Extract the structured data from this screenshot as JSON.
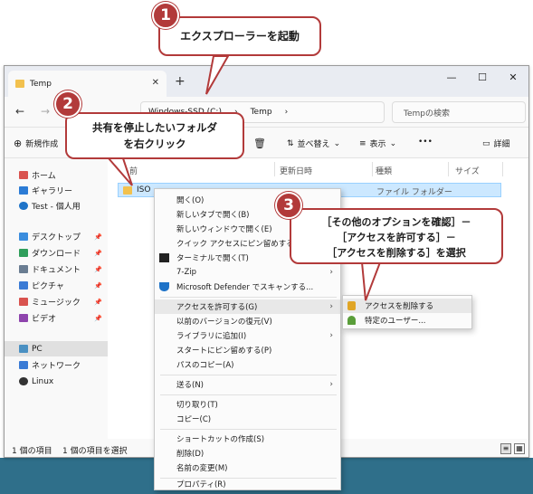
{
  "window": {
    "tab_title": "Temp",
    "controls": [
      "—",
      "☐",
      "✕"
    ],
    "address": {
      "drive": "Windows-SSD (C:)",
      "folder": "Temp"
    },
    "search_placeholder": "Tempの検索"
  },
  "toolbar": {
    "new_label": "新規作成",
    "sort_label": "並べ替え",
    "view_label": "表示",
    "more_label": "•••",
    "details_label": "詳細"
  },
  "navpane": {
    "items": [
      {
        "label": "ホーム",
        "icon": "home-icon",
        "color": "#d9534f"
      },
      {
        "label": "ギャラリー",
        "icon": "gallery-icon",
        "color": "#2b7bd5"
      },
      {
        "label": "Test - 個人用",
        "icon": "cloud-icon",
        "color": "#1e73c8"
      },
      {
        "label": "デスクトップ",
        "icon": "desktop-icon",
        "color": "#3a8dde",
        "pinned": true
      },
      {
        "label": "ダウンロード",
        "icon": "download-icon",
        "color": "#2f9e5b",
        "pinned": true
      },
      {
        "label": "ドキュメント",
        "icon": "documents-icon",
        "color": "#6a7d92",
        "pinned": true
      },
      {
        "label": "ピクチャ",
        "icon": "pictures-icon",
        "color": "#3a7bd5",
        "pinned": true
      },
      {
        "label": "ミュージック",
        "icon": "music-icon",
        "color": "#d9534f",
        "pinned": true
      },
      {
        "label": "ビデオ",
        "icon": "video-icon",
        "color": "#8e44ad",
        "pinned": true
      },
      {
        "label": "PC",
        "icon": "pc-icon",
        "color": "#4a90c2"
      },
      {
        "label": "ネットワーク",
        "icon": "network-icon",
        "color": "#3a7bd5"
      },
      {
        "label": "Linux",
        "icon": "linux-icon",
        "color": "#333333"
      }
    ]
  },
  "columns": {
    "name": "前",
    "modified": "更新日時",
    "type": "種類",
    "size": "サイズ"
  },
  "file": {
    "name": "ISO",
    "type": "ファイル フォルダー"
  },
  "status": {
    "count": "1 個の項目",
    "selected": "1 個の項目を選択"
  },
  "context_menu": {
    "items": [
      "開く(O)",
      "新しいタブで開く(B)",
      "新しいウィンドウで開く(E)",
      "クイック アクセスにピン留めする(Q)",
      "ターミナルで開く(T)",
      "7-Zip",
      "Microsoft Defender でスキャンする...",
      "アクセスを許可する(G)",
      "以前のバージョンの復元(V)",
      "ライブラリに追加(I)",
      "スタートにピン留めする(P)",
      "パスのコピー(A)",
      "送る(N)",
      "切り取り(T)",
      "コピー(C)",
      "ショートカットの作成(S)",
      "削除(D)",
      "名前の変更(M)",
      "プロパティ(R)"
    ],
    "submenu": [
      "アクセスを削除する",
      "特定のユーザー..."
    ]
  },
  "callouts": {
    "c1": {
      "num": "1",
      "text": "エクスプローラーを起動"
    },
    "c2": {
      "num": "2",
      "line1": "共有を停止したいフォルダ",
      "line2": "を右クリック"
    },
    "c3": {
      "num": "3",
      "line1": "［その他のオプションを確認］－",
      "line2": "［アクセスを許可する］－",
      "line3": "［アクセスを削除する］を選択"
    }
  },
  "colors": {
    "callout": "#b23a3a",
    "selection": "#cce8ff",
    "folder": "#f2c14e"
  }
}
